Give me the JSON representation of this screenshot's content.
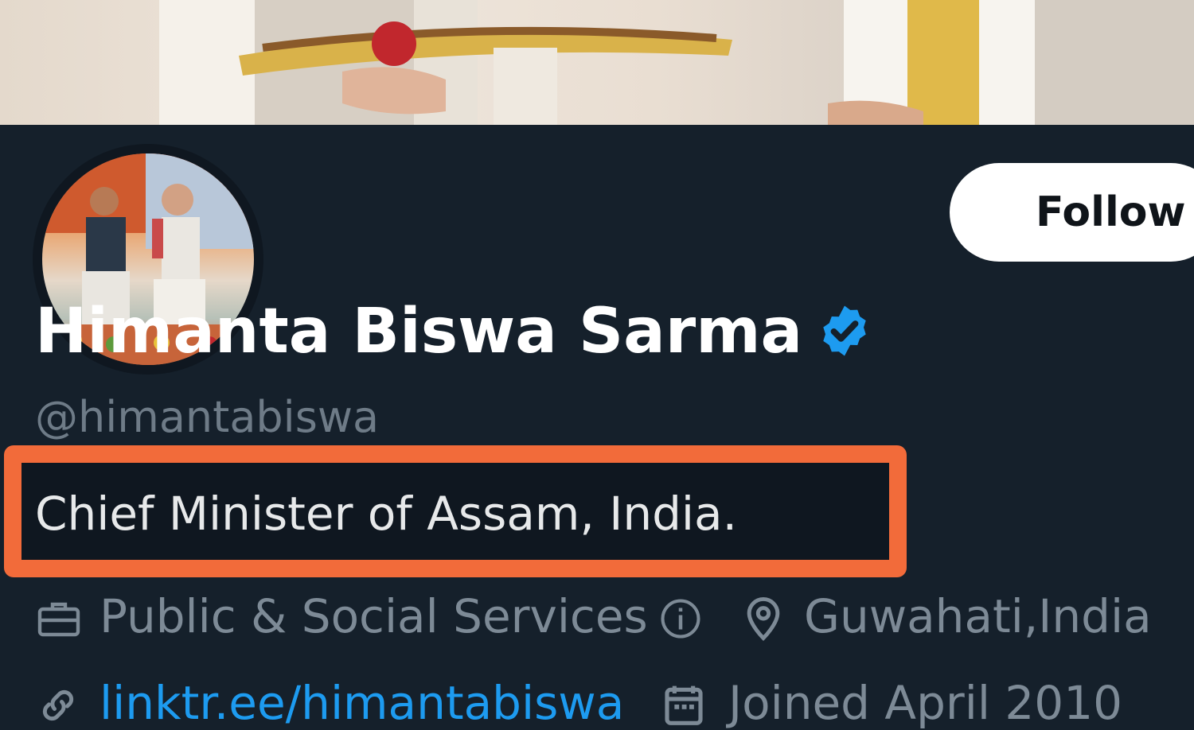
{
  "profile": {
    "display_name": "Himanta Biswa Sarma",
    "verified": true,
    "handle": "@himantabiswa",
    "bio": "Chief Minister of Assam, India.",
    "category": "Public & Social Services",
    "location": "Guwahati,India",
    "website": "linktr.ee/himantabiswa",
    "joined": "Joined April 2010"
  },
  "actions": {
    "follow_label": "Follow"
  },
  "colors": {
    "background": "#15202b",
    "accent": "#1d9bf0",
    "highlight": "#f26b3a",
    "verified": "#1d9bf0"
  },
  "icons": {
    "verified": "verified-badge-icon",
    "category": "briefcase-icon",
    "info": "info-icon",
    "location": "location-pin-icon",
    "link": "link-icon",
    "calendar": "calendar-icon"
  }
}
